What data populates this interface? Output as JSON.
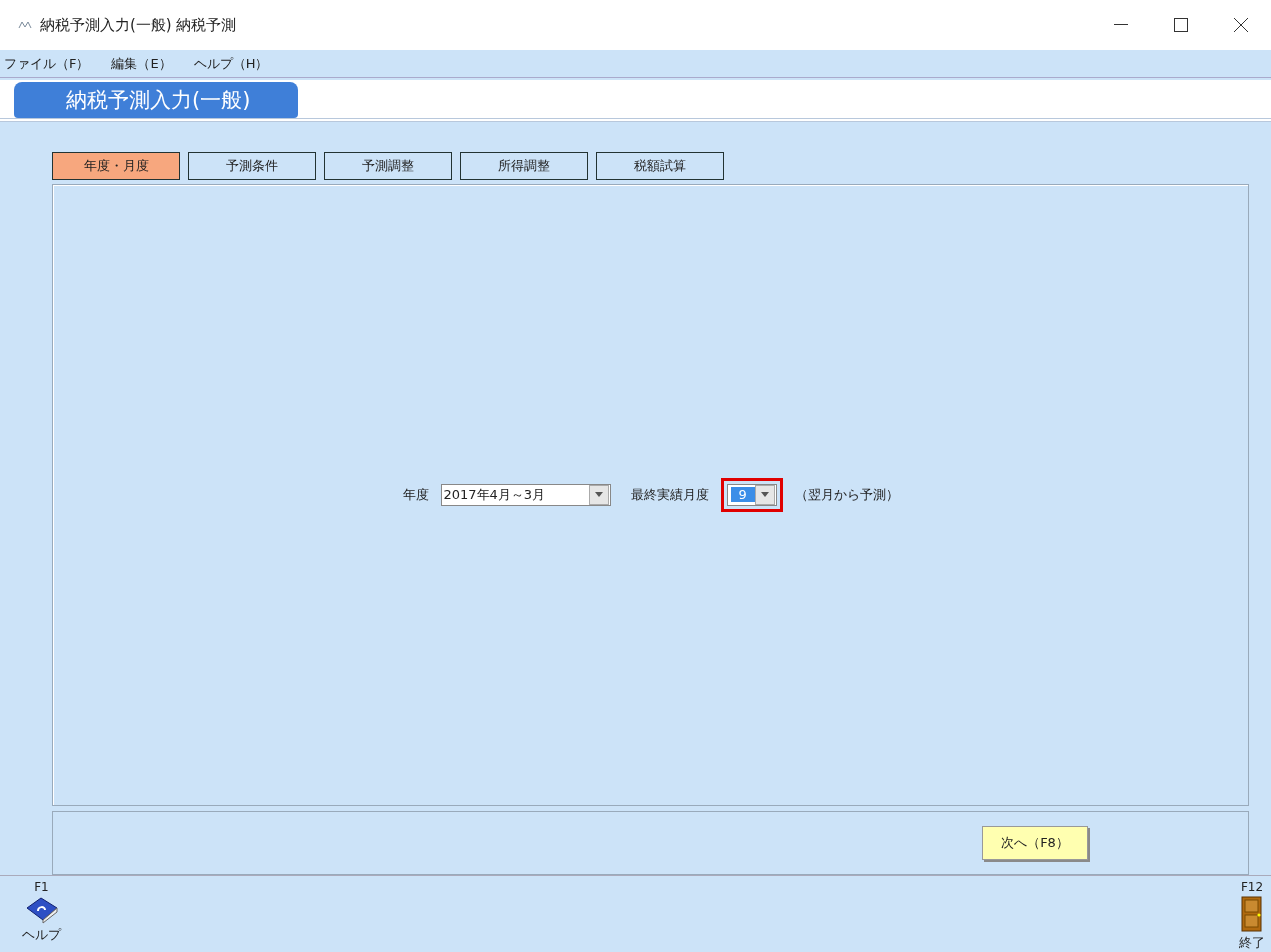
{
  "window": {
    "title": "納税予測入力(一般) 納税予測"
  },
  "menu": [
    "ファイル（F）",
    "編集（E）",
    "ヘルプ（H）"
  ],
  "page_title": "納税予測入力(一般)",
  "tabs": [
    {
      "label": "年度・月度",
      "selected": true
    },
    {
      "label": "予測条件",
      "selected": false
    },
    {
      "label": "予測調整",
      "selected": false
    },
    {
      "label": "所得調整",
      "selected": false
    },
    {
      "label": "税額試算",
      "selected": false
    }
  ],
  "form": {
    "year": {
      "label": "年度",
      "value": "2017年4月～3月"
    },
    "month": {
      "label": "最終実績月度",
      "value": "9",
      "focused": true
    },
    "note": "（翌月から予測）"
  },
  "next_button": "次へ（F8）",
  "function_keys": [
    {
      "key": "F1",
      "label": "ヘルプ",
      "kind": "help"
    },
    {
      "key": "F12",
      "label": "終了",
      "kind": "exit"
    }
  ]
}
